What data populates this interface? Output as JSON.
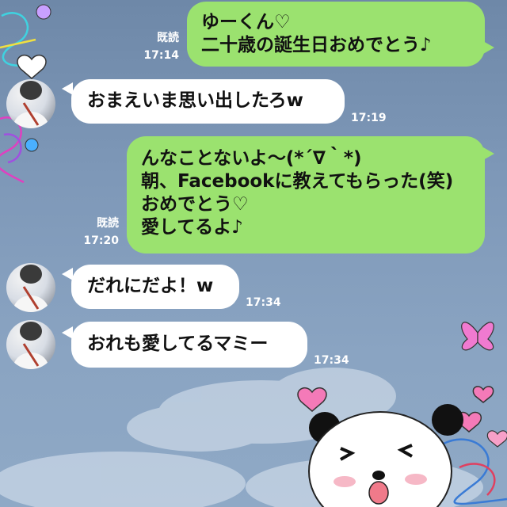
{
  "colors": {
    "background": "#7e98b8",
    "outgoing_bubble": "#9be26f",
    "incoming_bubble": "#ffffff",
    "meta_text": "#ffffff"
  },
  "messages": [
    {
      "direction": "outgoing",
      "read_label": "既読",
      "time": "17:14",
      "lines": [
        "ゆーくん♡",
        "二十歳の誕生日おめでとう♪"
      ]
    },
    {
      "direction": "incoming",
      "time": "17:19",
      "lines": [
        "おまえいま思い出したろw"
      ]
    },
    {
      "direction": "outgoing",
      "read_label": "既読",
      "time": "17:20",
      "lines": [
        "んなことないよ〜(*´∇｀*)",
        "朝、Facebookに教えてもらった(笑)",
        "おめでとう♡",
        "愛してるよ♪"
      ]
    },
    {
      "direction": "incoming",
      "time": "17:34",
      "lines": [
        "だれにだよ！w"
      ]
    },
    {
      "direction": "incoming",
      "time": "17:34",
      "lines": [
        "おれも愛してるマミー"
      ]
    }
  ],
  "decorations": [
    "heart-sticker",
    "butterfly-sticker",
    "flower-sticker",
    "panda-sticker",
    "cloud"
  ]
}
